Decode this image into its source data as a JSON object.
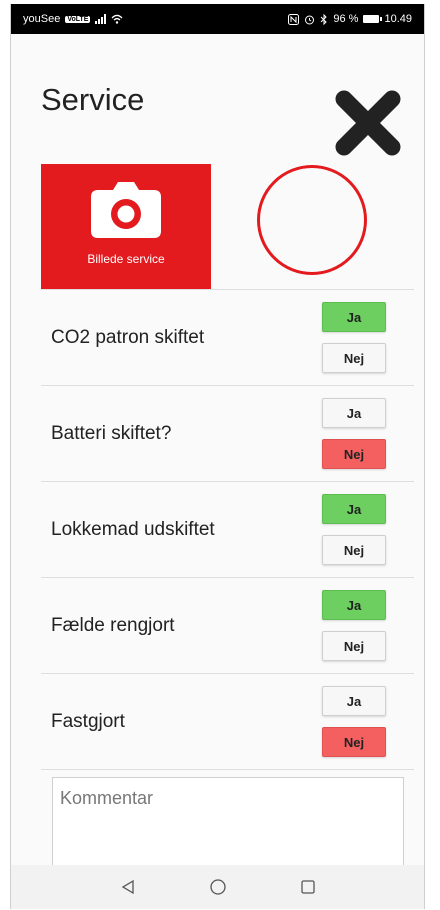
{
  "status_bar": {
    "carrier": "youSee",
    "carrier_badge": "VoLTE",
    "battery_percent": "96 %",
    "time": "10.49"
  },
  "header": {
    "title": "Service",
    "close_icon": "close-icon"
  },
  "photo": {
    "label": "Billede service",
    "icon": "camera-icon",
    "color": "#e31b1f"
  },
  "checklist": [
    {
      "label": "CO2 patron skiftet",
      "yes_label": "Ja",
      "no_label": "Nej",
      "selected": "Ja"
    },
    {
      "label": "Batteri skiftet?",
      "yes_label": "Ja",
      "no_label": "Nej",
      "selected": "Nej"
    },
    {
      "label": "Lokkemad udskiftet",
      "yes_label": "Ja",
      "no_label": "Nej",
      "selected": "Ja"
    },
    {
      "label": "Fælde rengjort",
      "yes_label": "Ja",
      "no_label": "Nej",
      "selected": "Ja"
    },
    {
      "label": "Fastgjort",
      "yes_label": "Ja",
      "no_label": "Nej",
      "selected": "Nej"
    }
  ],
  "comment": {
    "placeholder": "Kommentar",
    "value": ""
  },
  "colors": {
    "yes_selected": "#6ccf5f",
    "no_selected": "#f4605f",
    "accent": "#e31b1f"
  },
  "nav": {
    "back_icon": "back-triangle-icon",
    "home_icon": "home-circle-icon",
    "recents_icon": "recents-square-icon"
  }
}
